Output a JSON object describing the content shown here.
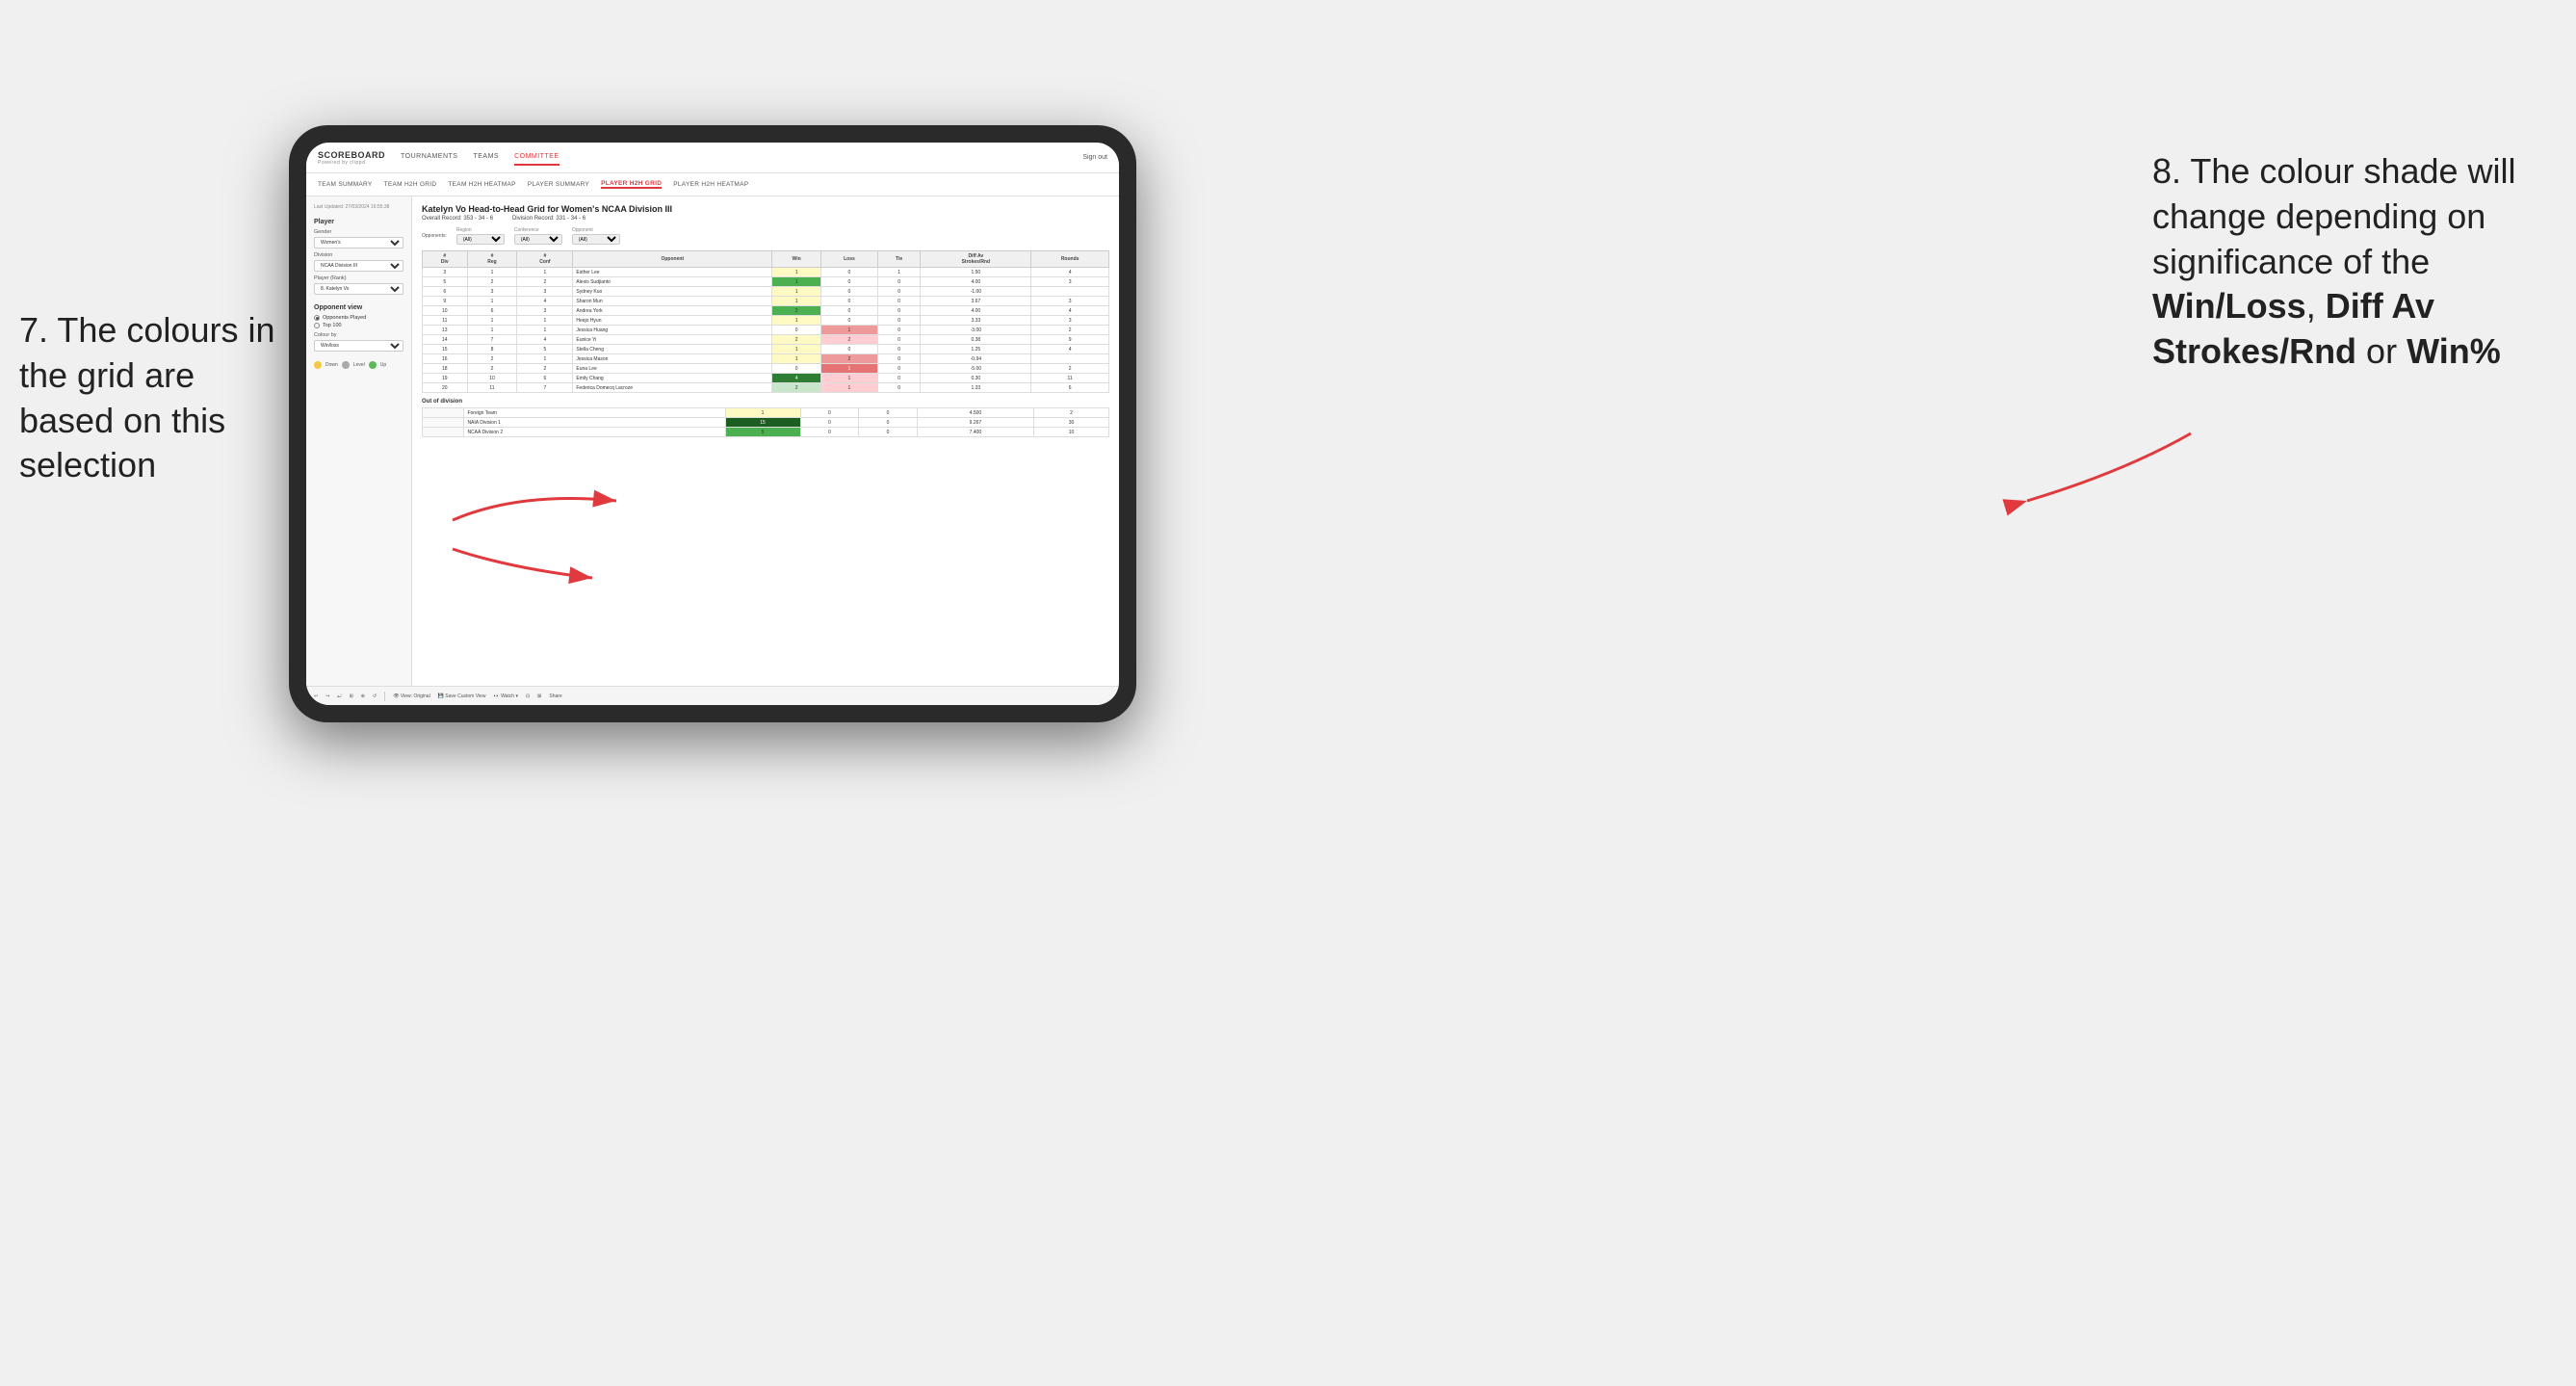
{
  "annotations": {
    "left": "7. The colours in the grid are based on this selection",
    "right_intro": "8. The colour shade will change depending on significance of the ",
    "right_bold1": "Win/Loss",
    "right_sep1": ", ",
    "right_bold2": "Diff Av Strokes/Rnd",
    "right_sep2": " or ",
    "right_bold3": "Win%"
  },
  "nav": {
    "logo": "SCOREBOARD",
    "logo_sub": "Powered by clippd",
    "items": [
      "TOURNAMENTS",
      "TEAMS",
      "COMMITTEE"
    ],
    "active": "COMMITTEE",
    "sign_out": "Sign out"
  },
  "sub_nav": {
    "items": [
      "TEAM SUMMARY",
      "TEAM H2H GRID",
      "TEAM H2H HEATMAP",
      "PLAYER SUMMARY",
      "PLAYER H2H GRID",
      "PLAYER H2H HEATMAP"
    ],
    "active": "PLAYER H2H GRID"
  },
  "left_panel": {
    "last_updated": "Last Updated: 27/03/2024\n16:55:38",
    "player_section": "Player",
    "gender_label": "Gender",
    "gender_value": "Women's",
    "division_label": "Division",
    "division_value": "NCAA Division III",
    "player_rank_label": "Player (Rank)",
    "player_rank_value": "8. Katelyn Vo",
    "opponent_view_label": "Opponent view",
    "opponents_played": "Opponents Played",
    "top_100": "Top 100",
    "colour_by_label": "Colour by",
    "colour_by_value": "Win/loss",
    "legend": {
      "down_label": "Down",
      "level_label": "Level",
      "up_label": "Up"
    }
  },
  "grid": {
    "title": "Katelyn Vo Head-to-Head Grid for Women's NCAA Division III",
    "overall_record": "Overall Record: 353 - 34 - 6",
    "division_record": "Division Record: 331 - 34 - 6",
    "filters": {
      "opponents_label": "Opponents:",
      "region_label": "Region",
      "conference_label": "Conference",
      "opponent_label": "Opponent",
      "region_value": "(All)",
      "conference_value": "(All)",
      "opponent_value": "(All)"
    },
    "columns": [
      "#\nDiv",
      "#\nReg",
      "#\nConf",
      "Opponent",
      "Win",
      "Loss",
      "Tie",
      "Diff Av\nStrokes/Rnd",
      "Rounds"
    ],
    "rows": [
      {
        "div": 3,
        "reg": 1,
        "conf": 1,
        "opponent": "Esther Lee",
        "win": 1,
        "loss": 0,
        "tie": 1,
        "diff": 1.5,
        "rounds": 4,
        "win_color": "yellow",
        "loss_color": "plain"
      },
      {
        "div": 5,
        "reg": 2,
        "conf": 2,
        "opponent": "Alexis Sudjianto",
        "win": 1,
        "loss": 0,
        "tie": 0,
        "diff": 4.0,
        "rounds": 3,
        "win_color": "green",
        "loss_color": "plain"
      },
      {
        "div": 6,
        "reg": 3,
        "conf": 3,
        "opponent": "Sydney Kuo",
        "win": 1,
        "loss": 0,
        "tie": 0,
        "diff": -1.0,
        "rounds": "",
        "win_color": "yellow",
        "loss_color": "plain"
      },
      {
        "div": 9,
        "reg": 1,
        "conf": 4,
        "opponent": "Sharon Mun",
        "win": 1,
        "loss": 0,
        "tie": 0,
        "diff": 3.67,
        "rounds": 3,
        "win_color": "yellow",
        "loss_color": "plain"
      },
      {
        "div": 10,
        "reg": 6,
        "conf": 3,
        "opponent": "Andrea York",
        "win": 2,
        "loss": 0,
        "tie": 0,
        "diff": 4.0,
        "rounds": 4,
        "win_color": "green",
        "loss_color": "plain"
      },
      {
        "div": 11,
        "reg": 1,
        "conf": 1,
        "opponent": "Heejo Hyun",
        "win": 1,
        "loss": 0,
        "tie": 0,
        "diff": 3.33,
        "rounds": 3,
        "win_color": "yellow",
        "loss_color": "plain"
      },
      {
        "div": 13,
        "reg": 1,
        "conf": 1,
        "opponent": "Jessica Huang",
        "win": 0,
        "loss": 1,
        "tie": 0,
        "diff": -3.0,
        "rounds": 2,
        "win_color": "plain",
        "loss_color": "red"
      },
      {
        "div": 14,
        "reg": 7,
        "conf": 4,
        "opponent": "Eunice Yi",
        "win": 2,
        "loss": 2,
        "tie": 0,
        "diff": 0.38,
        "rounds": 9,
        "win_color": "yellow",
        "loss_color": "red_light"
      },
      {
        "div": 15,
        "reg": 8,
        "conf": 5,
        "opponent": "Stella Cheng",
        "win": 1,
        "loss": 0,
        "tie": 0,
        "diff": 1.25,
        "rounds": 4,
        "win_color": "yellow",
        "loss_color": "plain"
      },
      {
        "div": 16,
        "reg": 2,
        "conf": 1,
        "opponent": "Jessica Mason",
        "win": 1,
        "loss": 2,
        "tie": 0,
        "diff": -0.94,
        "rounds": "",
        "win_color": "yellow",
        "loss_color": "red"
      },
      {
        "div": 18,
        "reg": 2,
        "conf": 2,
        "opponent": "Euna Lee",
        "win": 0,
        "loss": 1,
        "tie": 0,
        "diff": -5.0,
        "rounds": 2,
        "win_color": "plain",
        "loss_color": "red_dark"
      },
      {
        "div": 19,
        "reg": 10,
        "conf": 6,
        "opponent": "Emily Chang",
        "win": 4,
        "loss": 1,
        "tie": 0,
        "diff": 0.3,
        "rounds": 11,
        "win_color": "green_dark",
        "loss_color": "red_light"
      },
      {
        "div": 20,
        "reg": 11,
        "conf": 7,
        "opponent": "Federica Domecq Lacroze",
        "win": 2,
        "loss": 1,
        "tie": 0,
        "diff": 1.33,
        "rounds": 6,
        "win_color": "green",
        "loss_color": "red_light"
      }
    ],
    "out_of_division": {
      "title": "Out of division",
      "rows": [
        {
          "label": "Foreign Team",
          "win": 1,
          "loss": 0,
          "tie": 0,
          "diff": 4.5,
          "rounds": 2,
          "win_color": "yellow"
        },
        {
          "label": "NAIA Division 1",
          "win": 15,
          "loss": 0,
          "tie": 0,
          "diff": 9.267,
          "rounds": 30,
          "win_color": "green_dark"
        },
        {
          "label": "NCAA Division 2",
          "win": 5,
          "loss": 0,
          "tie": 0,
          "diff": 7.4,
          "rounds": 10,
          "win_color": "green"
        }
      ]
    }
  },
  "toolbar": {
    "buttons": [
      "↩",
      "↪",
      "⤾",
      "⊞",
      "⊛",
      "↺",
      "|",
      "View: Original",
      "Save Custom View",
      "Watch ▾",
      "⊡",
      "⊠",
      "Share"
    ]
  }
}
